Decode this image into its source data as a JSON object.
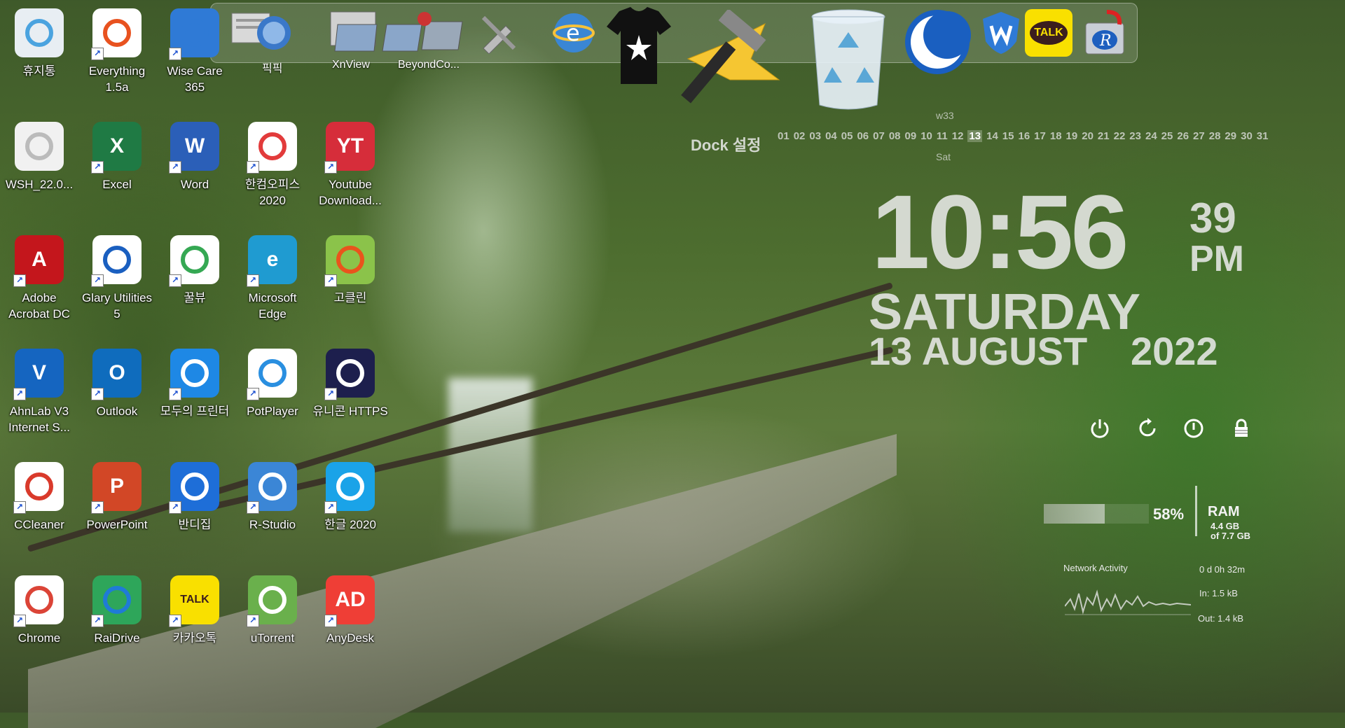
{
  "desktop": {
    "icons": [
      {
        "label": "휴지통"
      },
      {
        "label": "Everything 1.5a"
      },
      {
        "label": "Wise Care 365"
      },
      {
        "label": "WSH_22.0..."
      },
      {
        "label": "Excel"
      },
      {
        "label": "Word"
      },
      {
        "label": "한컴오피스 2020"
      },
      {
        "label": "Youtube Download..."
      },
      {
        "label": "Adobe Acrobat DC"
      },
      {
        "label": "Glary Utilities 5"
      },
      {
        "label": "꿀뷰"
      },
      {
        "label": "Microsoft Edge"
      },
      {
        "label": "고클린"
      },
      {
        "label": "AhnLab V3 Internet S..."
      },
      {
        "label": "Outlook"
      },
      {
        "label": "모두의 프린터"
      },
      {
        "label": "PotPlayer"
      },
      {
        "label": "유니콘 HTTPS"
      },
      {
        "label": "CCleaner"
      },
      {
        "label": "PowerPoint"
      },
      {
        "label": "반디집"
      },
      {
        "label": "R-Studio"
      },
      {
        "label": "한글 2020"
      },
      {
        "label": "Chrome"
      },
      {
        "label": "RaiDrive"
      },
      {
        "label": "카카오톡"
      },
      {
        "label": "uTorrent"
      },
      {
        "label": "AnyDesk"
      }
    ]
  },
  "dock": {
    "labels": {
      "picpick": "픽픽",
      "xnview": "XnView",
      "beyond": "BeyondCo..."
    },
    "tile_texts": {
      "talk": "TALK",
      "ie": "e",
      "rstudio": "R"
    },
    "caption": "Dock 설정"
  },
  "calendar": {
    "week": "w33",
    "days": [
      "01",
      "02",
      "03",
      "04",
      "05",
      "06",
      "07",
      "08",
      "09",
      "10",
      "11",
      "12",
      "13",
      "14",
      "15",
      "16",
      "17",
      "18",
      "19",
      "20",
      "21",
      "22",
      "23",
      "24",
      "25",
      "26",
      "27",
      "28",
      "29",
      "30",
      "31"
    ],
    "today": "13",
    "day_abbr": "Sat"
  },
  "clock": {
    "time": "10:56",
    "seconds": "39",
    "ampm": "PM",
    "weekday": "SATURDAY",
    "date": "13 AUGUST",
    "year": "2022"
  },
  "system": {
    "ram_percent_value": 58,
    "ram_percent": "58%",
    "ram_label": "RAM",
    "ram_used": "4.4 GB",
    "ram_total": "of 7.7 GB",
    "network_title": "Network Activity",
    "uptime": "0 d 0h 32m",
    "net_in": "In: 1.5 kB",
    "net_out": "Out: 1.4 kB"
  },
  "colors": {
    "excel": "#1f7a44",
    "word": "#2b5fb8",
    "acrobat": "#c4161c",
    "youtube_dl": "#d62d3a",
    "powerpoint": "#d24726",
    "anydesk": "#ef3e36",
    "kakao": "#f9e000",
    "edge": "#1f9bd1",
    "outlook": "#0f6cbd"
  }
}
